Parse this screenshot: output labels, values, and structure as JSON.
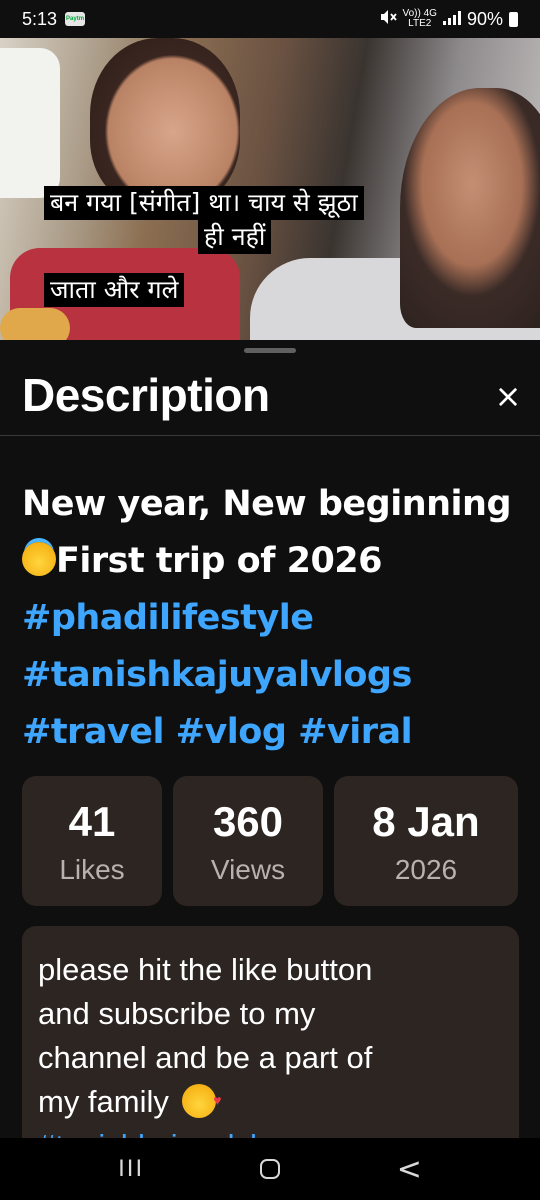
{
  "status_bar": {
    "time": "5:13",
    "paytm_badge": "Paytm",
    "network_label_top": "Vo)) 4G",
    "network_label_bottom": "LTE2",
    "battery": "90%",
    "icons": [
      "paytm-icon",
      "mute-icon",
      "signal-icon",
      "battery-icon"
    ]
  },
  "video": {
    "captions": [
      "बन गया [संगीत] था। चाय से झूठा",
      "ही नहीं",
      "जाता और गले"
    ]
  },
  "sheet": {
    "title": "Description",
    "close_glyph": "×",
    "video_title": {
      "part1": "New year, New beginning",
      "part2": "First trip of 2026 ",
      "hashtags": "#phadilifestyle #tanishkajuyalvlogs #travel #vlog #viral"
    },
    "stats": [
      {
        "value": "41",
        "label": "Likes"
      },
      {
        "value": "360",
        "label": "Views"
      },
      {
        "value": "8 Jan",
        "label": "2026"
      }
    ],
    "description": {
      "text": "please hit the like button and subscribe to my channel and be a part of my family",
      "tags": "#tanishkajuyalvlogs"
    }
  },
  "nav_bar": {
    "recents_glyph": "III",
    "back_glyph": "<"
  },
  "colors": {
    "background": "#0f0f0f",
    "card": "#2c2521",
    "hashtag": "#3ea6ff",
    "muted_text": "#b7b2ad"
  }
}
